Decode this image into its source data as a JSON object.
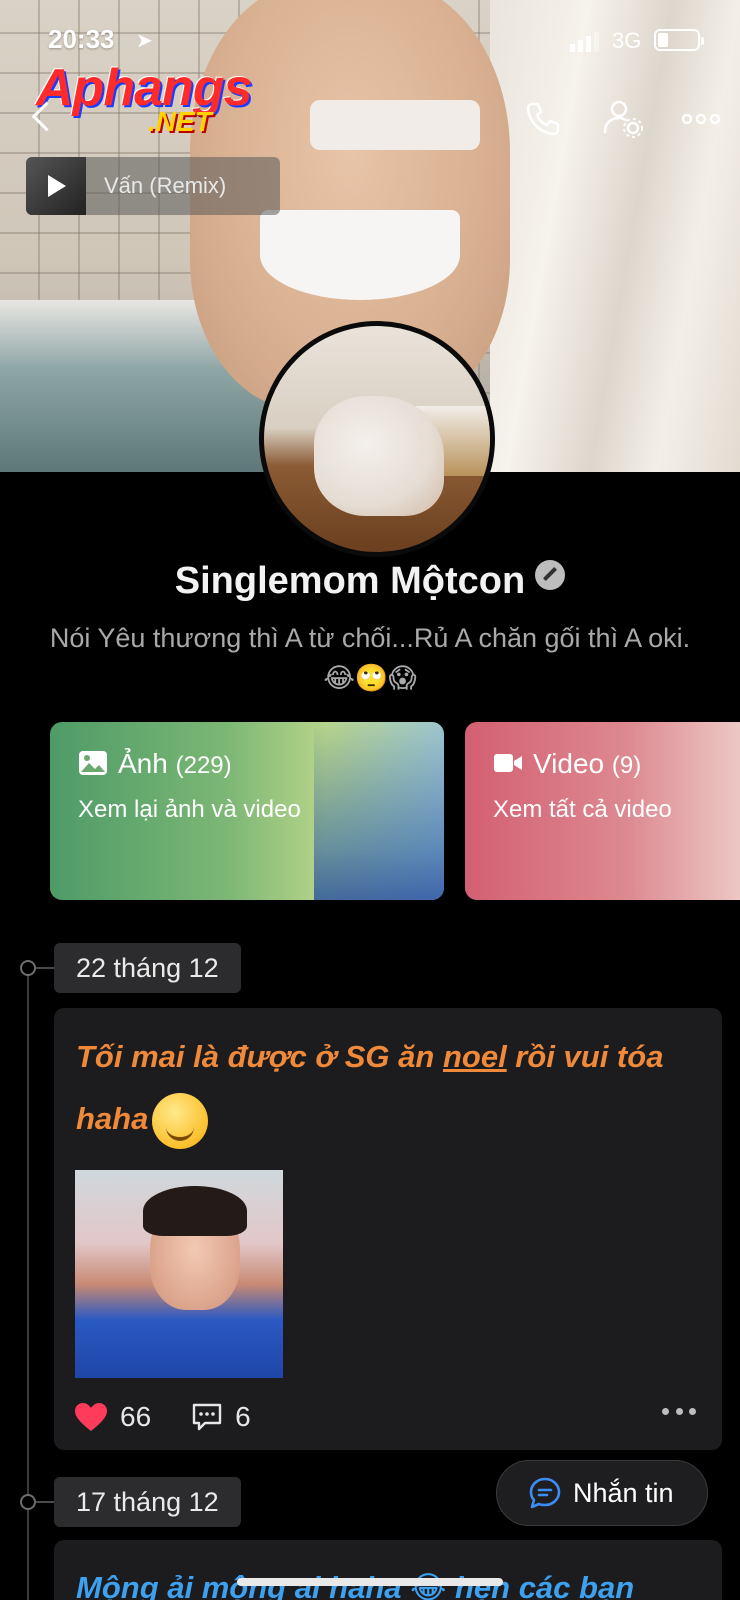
{
  "status_bar": {
    "time": "20:33",
    "network": "3G",
    "signal_bars": 3,
    "battery_level": 0.2
  },
  "watermark": {
    "brand": "Aphangs",
    "tld": ".NET"
  },
  "header": {
    "music_title": "Vấn (Remix)"
  },
  "profile": {
    "name": "Singlemom Mộtcon",
    "bio": "Nói Yêu thương thì A từ chối...Rủ A chăn gối thì A oki.😂🙄😱"
  },
  "cards": {
    "photos": {
      "title": "Ảnh",
      "count": "(229)",
      "subtitle": "Xem lại ảnh và video"
    },
    "videos": {
      "title": "Video",
      "count": "(9)",
      "subtitle": "Xem tất cả video"
    }
  },
  "timeline": {
    "date1": "22 tháng 12",
    "date2": "17 tháng 12"
  },
  "post1": {
    "text_a": "Tối mai là được ở SG ăn ",
    "text_link": "noel",
    "text_b": " rồi vui tóa haha",
    "likes": "66",
    "comments": "6"
  },
  "post2": {
    "text": "Mộng ải mộng ai haha 😂 hẹn các bạn"
  },
  "message_button": {
    "label": "Nhắn tin"
  },
  "colors": {
    "accent_post1": "#f08a3a",
    "accent_post2": "#3ea1f0",
    "like_heart": "#ff3b5c"
  }
}
